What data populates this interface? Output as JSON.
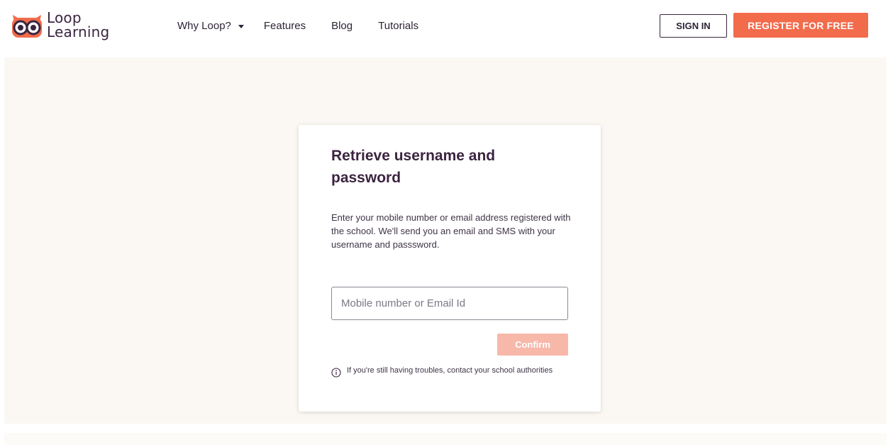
{
  "brand": {
    "line1": "Loop",
    "line2": "Learning",
    "icon": "owl-logo-icon",
    "owl_color": "#f26b4b",
    "eye_color": "#3b2440"
  },
  "nav": {
    "items": [
      {
        "label": "Why Loop?",
        "icon": "caret-down-icon"
      },
      {
        "label": "Features"
      },
      {
        "label": "Blog"
      },
      {
        "label": "Tutorials"
      }
    ]
  },
  "header_actions": {
    "sign_in": "SIGN IN",
    "register": "REGISTER FOR FREE"
  },
  "card": {
    "title": "Retrieve username and password",
    "description": "Enter your mobile number or email address registered with the school. We'll send you an email and SMS with your username and passsword.",
    "input": {
      "value": "",
      "placeholder": "Mobile number or Email Id"
    },
    "confirm_label": "Confirm",
    "help_icon": "info-icon",
    "help_text": "If you're still having troubles, contact your school authorities"
  },
  "colors": {
    "accent": "#f26b4b",
    "accent_disabled": "#f7b8a9",
    "text_dark": "#3b2440",
    "band_background": "#fbf8f3"
  }
}
